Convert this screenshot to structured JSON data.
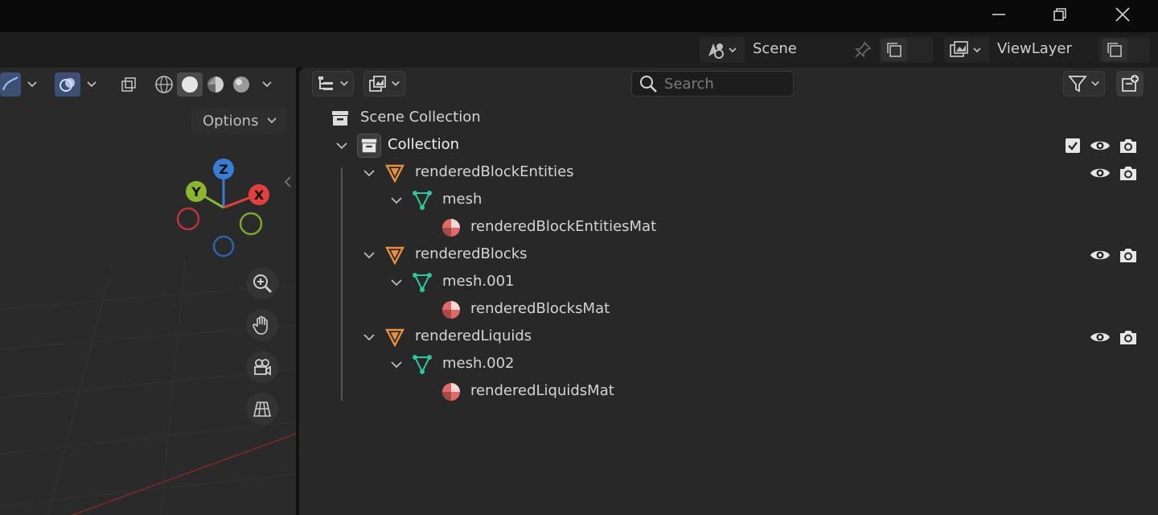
{
  "topbar": {
    "scene_label": "Scene",
    "viewlayer_label": "ViewLayer"
  },
  "viewport": {
    "options_label": "Options",
    "gizmo": {
      "z": "Z",
      "y": "Y",
      "x": "X"
    }
  },
  "outliner": {
    "search_placeholder": "Search",
    "tree": [
      {
        "label": "Scene Collection",
        "type": "scene-collection",
        "depth": 0
      },
      {
        "label": "Collection",
        "type": "collection",
        "depth": 1,
        "checked": true
      },
      {
        "label": "renderedBlockEntities",
        "type": "object",
        "depth": 2
      },
      {
        "label": "mesh",
        "type": "mesh",
        "depth": 3
      },
      {
        "label": "renderedBlockEntitiesMat",
        "type": "material",
        "depth": 4
      },
      {
        "label": "renderedBlocks",
        "type": "object",
        "depth": 2
      },
      {
        "label": "mesh.001",
        "type": "mesh",
        "depth": 3
      },
      {
        "label": "renderedBlocksMat",
        "type": "material",
        "depth": 4
      },
      {
        "label": "renderedLiquids",
        "type": "object",
        "depth": 2
      },
      {
        "label": "mesh.002",
        "type": "mesh",
        "depth": 3
      },
      {
        "label": "renderedLiquidsMat",
        "type": "material",
        "depth": 4
      }
    ]
  },
  "colors": {
    "object": "#e8913a",
    "mesh": "#2ec6a0",
    "material": "#e06a6a",
    "gizmo_x": "#e0413f",
    "gizmo_y": "#8ab632",
    "gizmo_z": "#3a7bd6"
  },
  "icons": {
    "minimize": "minimize-icon",
    "restore": "restore-icon",
    "close": "close-icon",
    "scene": "scene-icon",
    "pin": "pin-icon",
    "copy": "copy-icon",
    "viewlayer": "render-layer-icon",
    "search": "search-icon",
    "filter": "filter-icon",
    "new_collection": "new-collection-icon",
    "eye": "eye-icon",
    "camera": "camera-icon",
    "zoom": "zoom-icon",
    "pan": "hand-icon",
    "camera_view": "camera-view-icon",
    "ortho": "grid-icon"
  }
}
